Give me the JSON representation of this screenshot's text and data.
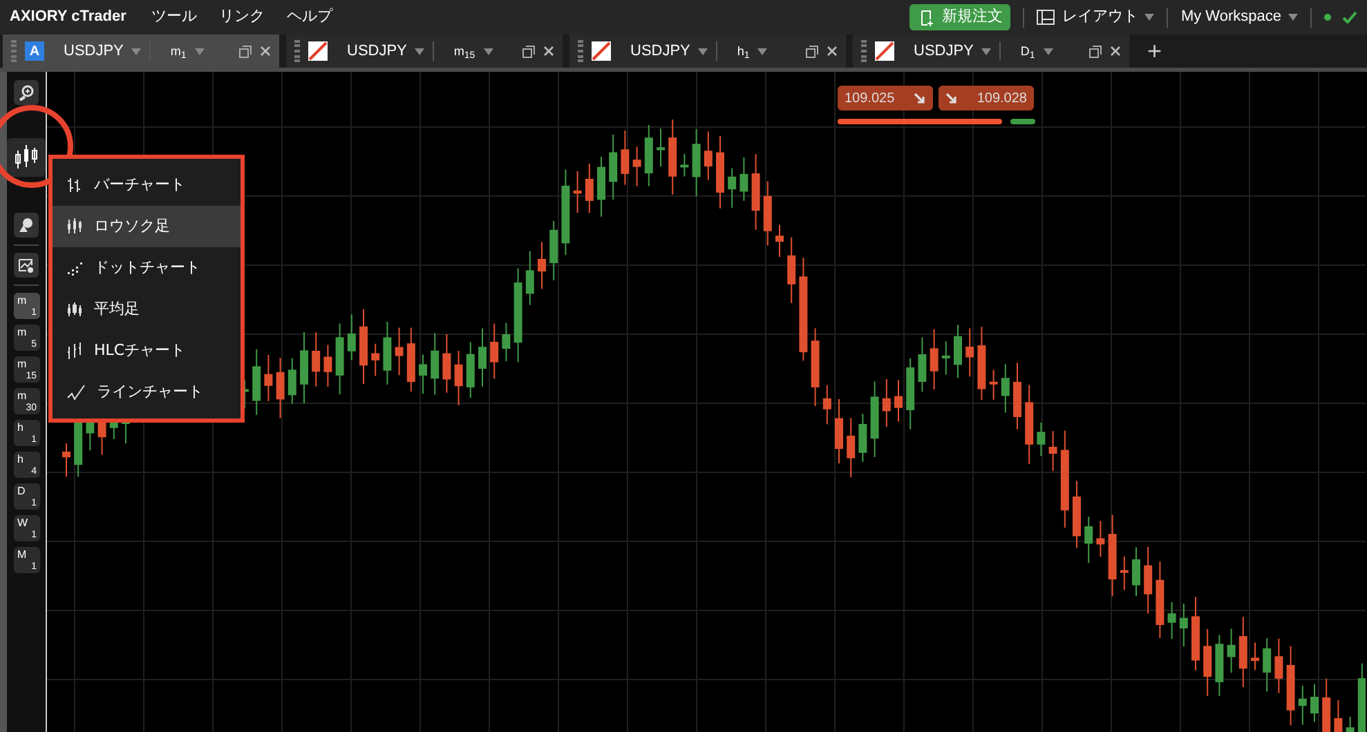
{
  "menu_bar": {
    "app_name": "AXIORY cTrader",
    "items": [
      "ツール",
      "リンク",
      "ヘルプ"
    ]
  },
  "toolbar_right": {
    "new_order": "新規注文",
    "layout": "レイアウト",
    "workspace": "My Workspace"
  },
  "tabs": [
    {
      "kind": "letter",
      "icon_text": "A",
      "symbol": "USDJPY",
      "period": "m",
      "period_num": "1",
      "selected": true
    },
    {
      "kind": "slash",
      "symbol": "USDJPY",
      "period": "m",
      "period_num": "15",
      "selected": false
    },
    {
      "kind": "slash",
      "symbol": "USDJPY",
      "period": "h",
      "period_num": "1",
      "selected": false
    },
    {
      "kind": "slash",
      "symbol": "USDJPY",
      "period": "D",
      "period_num": "1",
      "selected": false
    }
  ],
  "add_tab": "+",
  "timeframes": [
    {
      "letter": "m",
      "num": "1",
      "selected": true
    },
    {
      "letter": "m",
      "num": "5",
      "selected": false
    },
    {
      "letter": "m",
      "num": "15",
      "selected": false
    },
    {
      "letter": "m",
      "num": "30",
      "selected": false
    },
    {
      "letter": "h",
      "num": "1",
      "selected": false
    },
    {
      "letter": "h",
      "num": "4",
      "selected": false
    },
    {
      "letter": "D",
      "num": "1",
      "selected": false
    },
    {
      "letter": "W",
      "num": "1",
      "selected": false
    },
    {
      "letter": "M",
      "num": "1",
      "selected": false
    }
  ],
  "chart_type_menu": [
    {
      "kind": "bar",
      "label": "バーチャート",
      "selected": false
    },
    {
      "kind": "candle",
      "label": "ロウソク足",
      "selected": true
    },
    {
      "kind": "dot",
      "label": "ドットチャート",
      "selected": false
    },
    {
      "kind": "heikin",
      "label": "平均足",
      "selected": false
    },
    {
      "kind": "hlc",
      "label": "HLCチャート",
      "selected": false
    },
    {
      "kind": "line",
      "label": "ラインチャート",
      "selected": false
    }
  ],
  "quote": {
    "sell": "109.025",
    "buy": "109.028",
    "sentiment": {
      "level": 0.83
    }
  }
}
